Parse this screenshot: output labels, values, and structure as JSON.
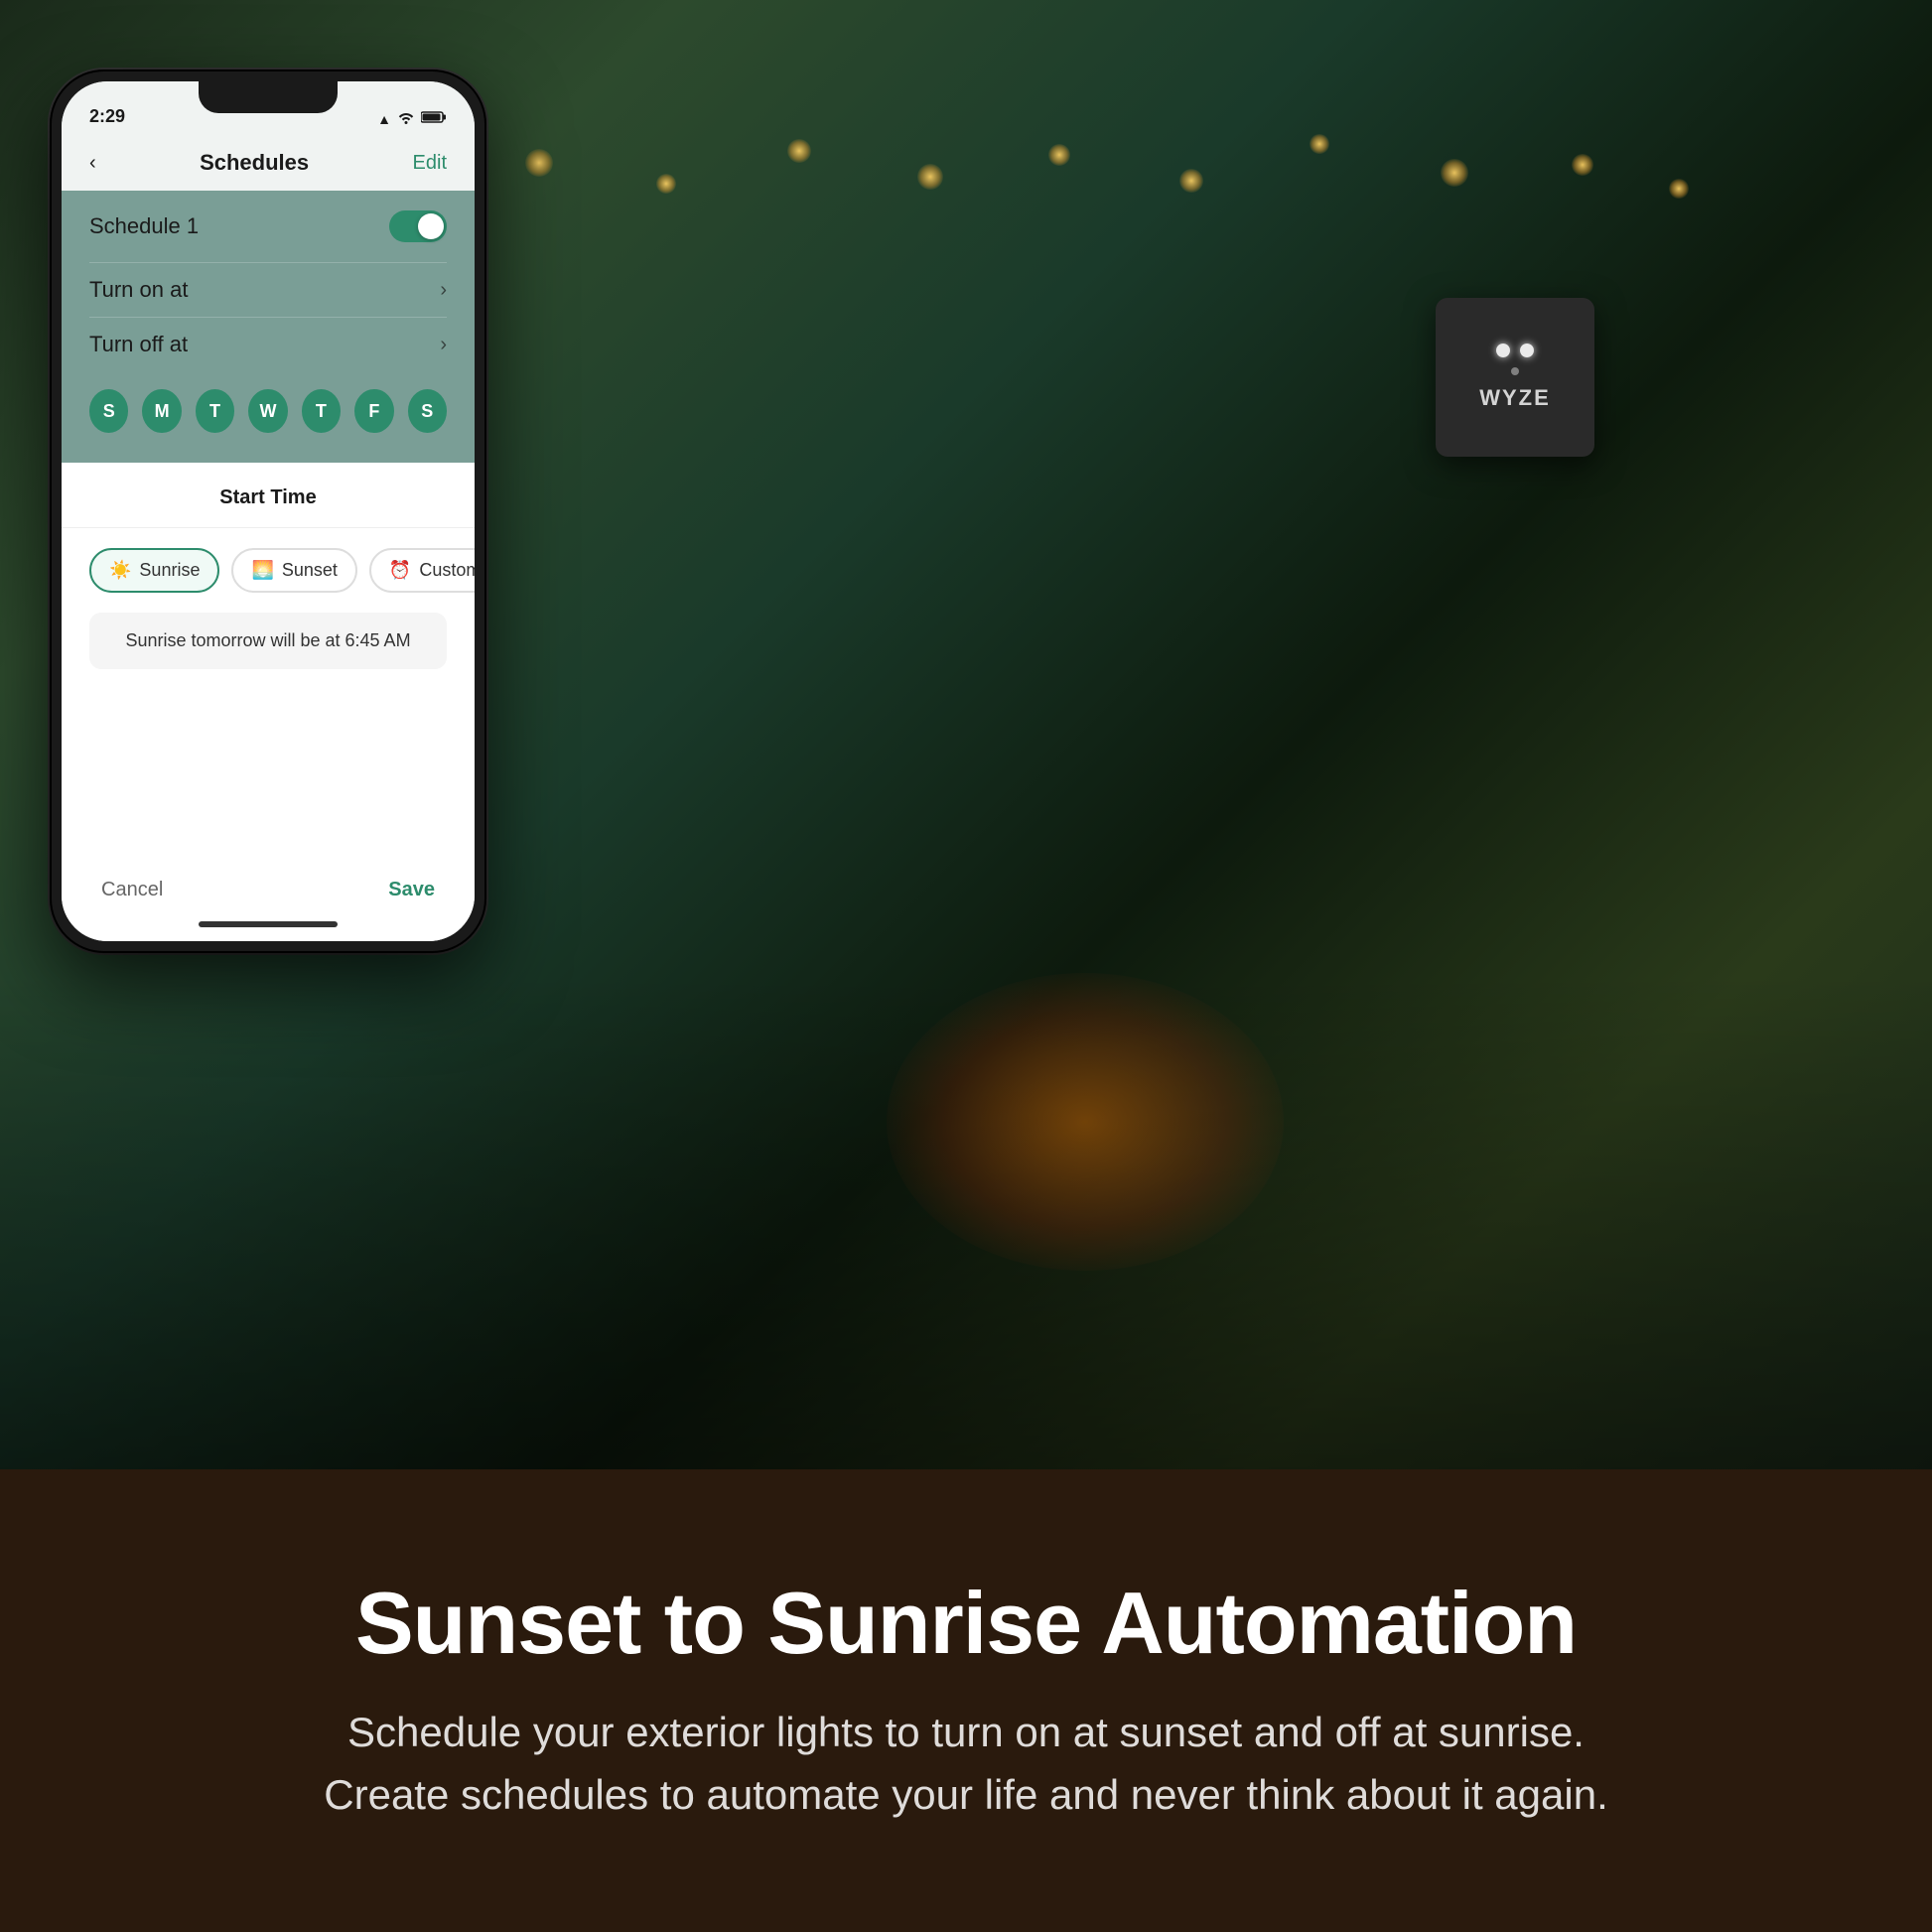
{
  "scene": {
    "background_description": "outdoor evening scene with string lights and fire pit"
  },
  "bottom_section": {
    "main_title": "Sunset to Sunrise Automation",
    "subtitle_line1": "Schedule your exterior lights to turn on at sunset and off at sunrise.",
    "subtitle_line2": "Create schedules to automate your life and never think about it again."
  },
  "phone": {
    "status_bar": {
      "time": "2:29",
      "signal_icon": "▲",
      "wifi_icon": "wifi",
      "battery_icon": "battery"
    },
    "nav": {
      "back_label": "‹",
      "title": "Schedules",
      "edit_label": "Edit"
    },
    "schedule": {
      "label": "Schedule 1",
      "toggle_on": true
    },
    "turn_on_label": "Turn on at",
    "turn_off_label": "Turn off at",
    "days": [
      "S",
      "M",
      "T",
      "W",
      "T",
      "F",
      "S"
    ],
    "bottom_sheet": {
      "title": "Start Time",
      "options": [
        {
          "label": "Sunrise",
          "icon": "☀",
          "active": true
        },
        {
          "label": "Sunset",
          "icon": "🌅",
          "active": false
        },
        {
          "label": "Custom",
          "icon": "⏰",
          "active": false
        }
      ],
      "sunrise_info": "Sunrise tomorrow will be at 6:45 AM",
      "cancel_label": "Cancel",
      "save_label": "Save"
    }
  },
  "wyze_device": {
    "brand": "WYZE",
    "lights_count": 2
  }
}
